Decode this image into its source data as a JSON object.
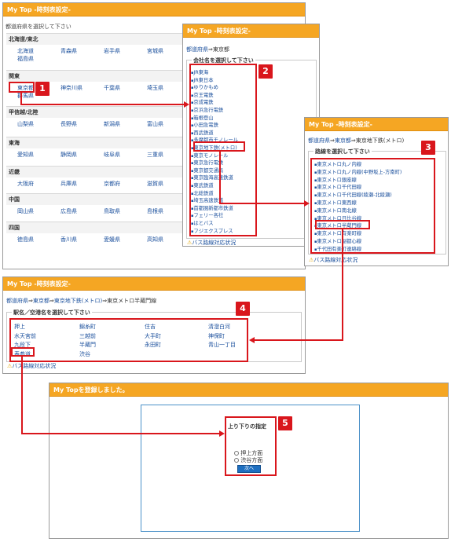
{
  "accent_color": "#f5a623",
  "highlight_color": "#d9161c",
  "win1": {
    "title": "My Top -時刻表設定-",
    "prompt": "都道府県を選択して下さい",
    "regions": [
      {
        "name": "北海道/東北",
        "prefs": [
          "北海道",
          "青森県",
          "岩手県",
          "宮城県",
          "福島県"
        ]
      },
      {
        "name": "関東",
        "prefs": [
          "東京都",
          "神奈川県",
          "千葉県",
          "埼玉県",
          "群馬県"
        ]
      },
      {
        "name": "甲信越/北陸",
        "prefs": [
          "山梨県",
          "長野県",
          "新潟県",
          "富山県"
        ]
      },
      {
        "name": "東海",
        "prefs": [
          "愛知県",
          "静岡県",
          "岐阜県",
          "三重県"
        ]
      },
      {
        "name": "近畿",
        "prefs": [
          "大阪府",
          "兵庫県",
          "京都府",
          "滋賀県"
        ]
      },
      {
        "name": "中国",
        "prefs": [
          "岡山県",
          "広島県",
          "鳥取県",
          "島根県"
        ]
      },
      {
        "name": "四国",
        "prefs": [
          "徳島県",
          "香川県",
          "愛媛県",
          "高知県"
        ]
      }
    ]
  },
  "win2": {
    "title": "My Top -時刻表設定-",
    "crumb": {
      "root": "都道府県",
      "sep": "⇒",
      "cur": "東京都"
    },
    "legend": "会社名を選択して下さい",
    "companies": [
      "JR東海",
      "JR東日本",
      "ゆりかもめ",
      "京王電鉄",
      "京成電鉄",
      "京浜急行電鉄",
      "箱根登山",
      "小田急電鉄",
      "西武鉄道",
      "多摩都市モノレール",
      "東京地下鉄(メトロ)",
      "東京モノレール",
      "東京急行電鉄",
      "東京都交通局",
      "東京臨海高速鉄道",
      "東武鉄道",
      "北総鉄道",
      "埼玉高速鉄道",
      "首都圏新都市鉄道",
      "フェリー各社",
      "はとバス",
      "フジエクスプレス"
    ],
    "bus": "バス路線対応状況"
  },
  "win3": {
    "title": "My Top -時刻表設定-",
    "crumb": {
      "root": "都道府県",
      "sep": "⇒",
      "mid": "東京都",
      "cur": "東京地下鉄(メトロ)"
    },
    "legend": "路線を選択して下さい",
    "lines": [
      "東京メトロ丸ノ内線",
      "東京メトロ丸ノ内線(中野坂上-方南町)",
      "東京メトロ銀座線",
      "東京メトロ千代田線",
      "東京メトロ千代田線(綾瀬-北綾瀬)",
      "東京メトロ東西線",
      "東京メトロ南北線",
      "東京メトロ日比谷線",
      "東京メトロ半蔵門線",
      "東京メトロ有楽町線",
      "東京メトロ副都心線",
      "千代田有楽町連絡線"
    ],
    "bus": "バス路線対応状況"
  },
  "win4": {
    "title": "My Top -時刻表設定-",
    "crumb": {
      "root": "都道府県",
      "sep": "⇒",
      "a": "東京都",
      "b": "東京地下鉄(メトロ)",
      "cur": "東京メトロ半蔵門線"
    },
    "legend": "駅名／空港名を選択して下さい",
    "stations": [
      [
        "押上",
        "錦糸町",
        "住吉",
        "清澄白河"
      ],
      [
        "水天宮前",
        "三越前",
        "大手町",
        "神保町"
      ],
      [
        "九段下",
        "半蔵門",
        "永田町",
        "青山一丁目"
      ],
      [
        "表参道",
        "渋谷",
        "",
        ""
      ]
    ],
    "bus": "バス路線対応状況"
  },
  "win5": {
    "title": "My Topを登録しました。",
    "legend": "上り下りの指定",
    "options": [
      "押上方面",
      "渋谷方面"
    ],
    "next": "次へ"
  },
  "steps": [
    "1",
    "2",
    "3",
    "4",
    "5"
  ]
}
